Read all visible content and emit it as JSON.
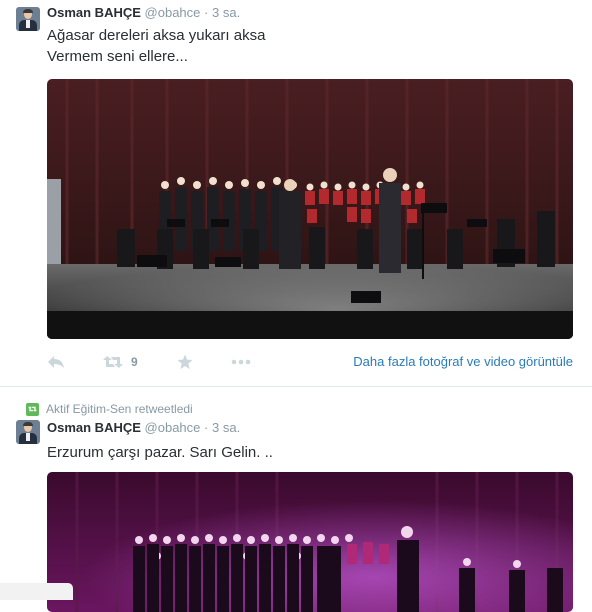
{
  "tweets": [
    {
      "author": {
        "name": "Osman BAHÇE",
        "handle": "@obahce",
        "separator": "·",
        "time": "3 sa."
      },
      "text_lines": [
        "Ağasar dereleri aksa yukarı aksa",
        "Vermem seni ellere..."
      ],
      "photo_icon": "concert-stage-photo",
      "actions": {
        "reply_icon": "reply-icon",
        "retweet_icon": "retweet-icon",
        "retweet_count": "9",
        "favorite_icon": "star-icon",
        "more_icon": "more-dots-icon",
        "media_link": "Daha fazla fotoğraf ve video görüntüle"
      }
    },
    {
      "retweeted_by": "Aktif Eğitim-Sen retweetledi",
      "author": {
        "name": "Osman BAHÇE",
        "handle": "@obahce",
        "separator": "·",
        "time": "3 sa."
      },
      "text_lines": [
        "Erzurum çarşı pazar. Sarı Gelin. .."
      ],
      "photo_icon": "concert-purple-light-photo"
    }
  ],
  "colors": {
    "link": "#2b7bb9",
    "muted": "#8899a6",
    "text": "#292f33",
    "retweet_green": "#5fb95b",
    "divider": "#e1e8ed"
  }
}
